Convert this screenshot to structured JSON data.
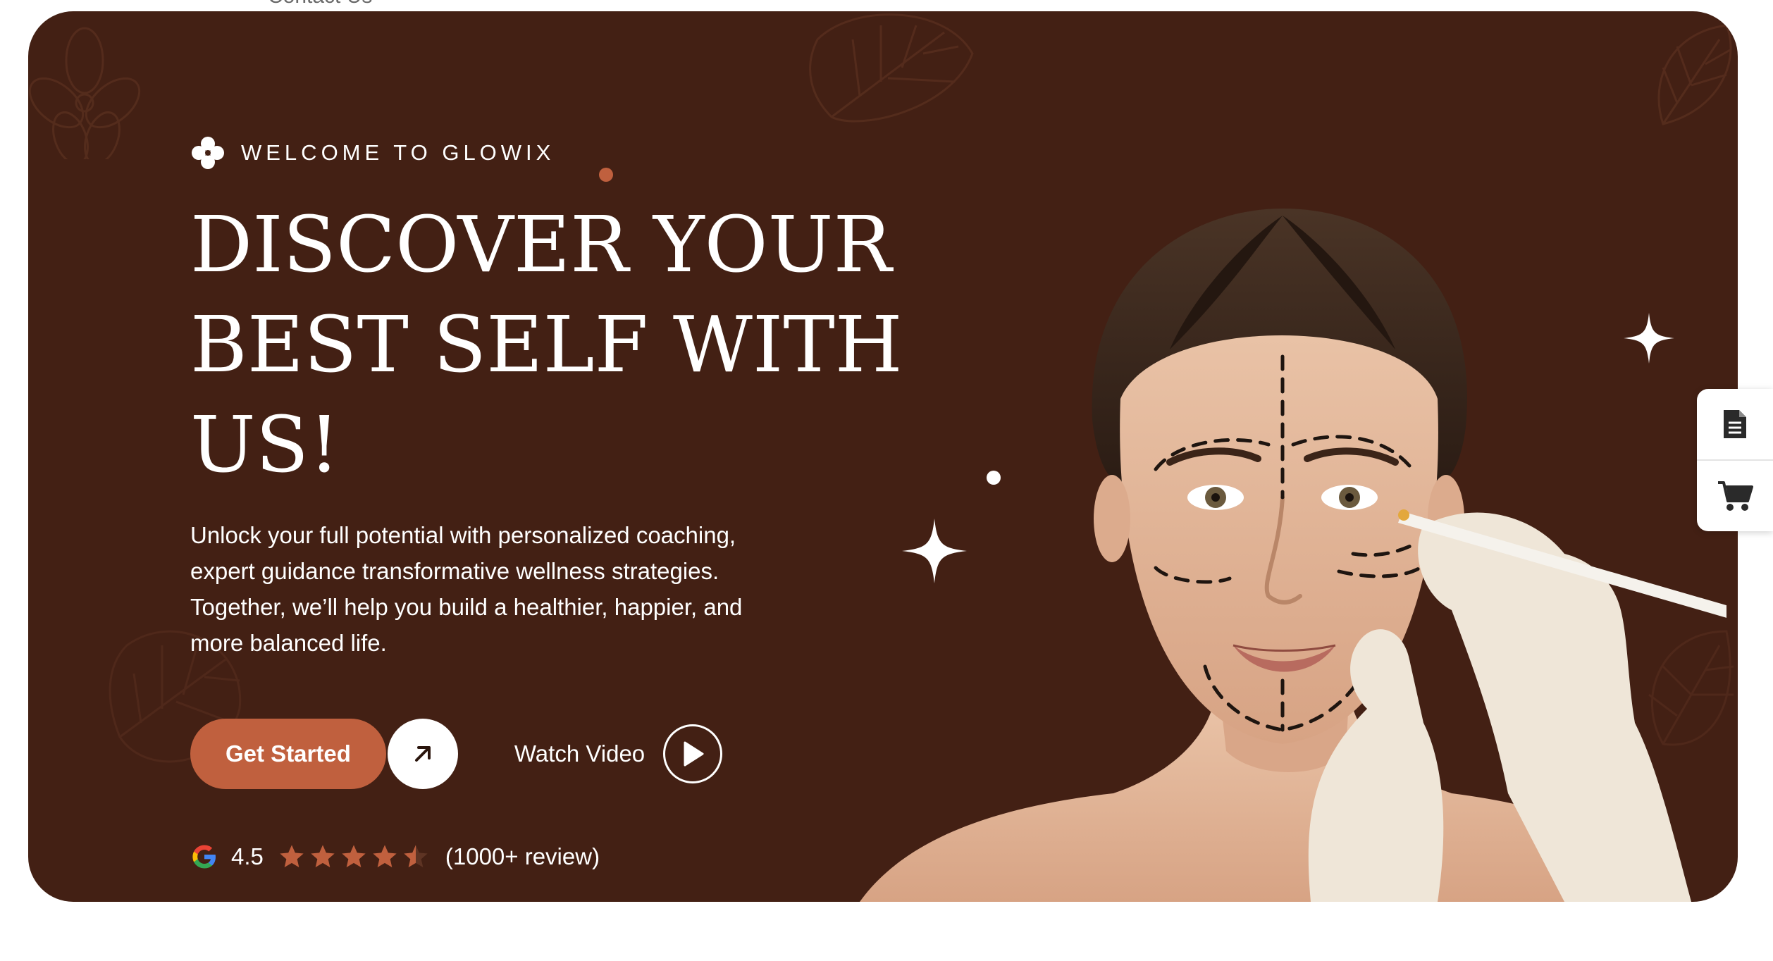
{
  "nav": {
    "contact_label": "Contact Us"
  },
  "hero": {
    "eyebrow": "WELCOME TO GLOWIX",
    "title_lines": [
      "DISCOVER YOUR",
      "BEST SELF WITH",
      "US!"
    ],
    "description_lines": [
      "Unlock your full potential with personalized coaching,",
      "expert guidance transformative wellness strategies.",
      "Together, we’ll help you build a healthier, happier, and",
      "more balanced life."
    ],
    "primary_button": "Get Started",
    "video_button": "Watch Video",
    "rating": {
      "score": "4.5",
      "stars": 4.5,
      "reviews": "(1000+ review)"
    }
  },
  "colors": {
    "hero_bg": "#432014",
    "accent": "#c0603e",
    "text": "#ffffff"
  },
  "icons": [
    "flower-icon",
    "arrow-up-right-icon",
    "play-icon",
    "google-icon",
    "star-icon",
    "document-icon",
    "cart-icon",
    "sparkle-icon",
    "leaf-icon"
  ]
}
